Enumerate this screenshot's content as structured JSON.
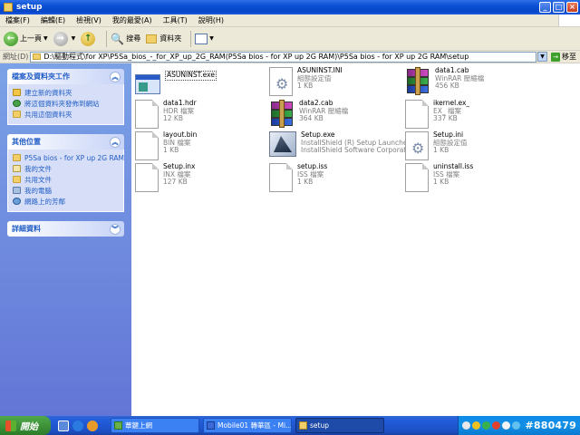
{
  "window": {
    "title": "setup"
  },
  "menu": [
    "檔案(F)",
    "編輯(E)",
    "檢視(V)",
    "我的最愛(A)",
    "工具(T)",
    "說明(H)"
  ],
  "toolbar": {
    "back": "上一頁",
    "search": "搜尋",
    "folders": "資料夾"
  },
  "address": {
    "label": "網址(D)",
    "value": "D:\\驅動程式\\for XP\\P5Sa_bios_-_for_XP_up_2G_RAM(P5Sa bios - for XP up 2G RAM)\\P5Sa bios - for XP up 2G RAM\\setup",
    "go": "移至"
  },
  "side": {
    "tasks": {
      "title": "檔案及資料夾工作",
      "items": [
        "建立新的資料夾",
        "將這個資料夾發佈到網站",
        "共用這個資料夾"
      ]
    },
    "places": {
      "title": "其他位置",
      "items": [
        "P5Sa bios - for XP up 2G RAM",
        "我的文件",
        "共用文件",
        "我的電腦",
        "網路上的芳鄰"
      ]
    },
    "details": {
      "title": "詳細資料"
    }
  },
  "files": [
    {
      "name": "ASUNINST.exe",
      "type": "",
      "size": "",
      "icon": "window-icon"
    },
    {
      "name": "ASUNINST.INI",
      "type": "組態設定值",
      "size": "1 KB",
      "icon": "gear-icon"
    },
    {
      "name": "data1.cab",
      "type": "WinRAR 壓縮檔",
      "size": "456 KB",
      "icon": "rar-icon"
    },
    {
      "name": "data1.hdr",
      "type": "HDR 檔案",
      "size": "12 KB",
      "icon": "file-icon"
    },
    {
      "name": "data2.cab",
      "type": "WinRAR 壓縮檔",
      "size": "364 KB",
      "icon": "rar-icon"
    },
    {
      "name": "ikernel.ex_",
      "type": "EX_ 檔案",
      "size": "337 KB",
      "icon": "file-icon"
    },
    {
      "name": "layout.bin",
      "type": "BIN 檔案",
      "size": "1 KB",
      "icon": "file-icon"
    },
    {
      "name": "Setup.exe",
      "type": "InstallShield (R) Setup Launcher",
      "size": "InstallShield Software Corporation",
      "icon": "installer-icon"
    },
    {
      "name": "Setup.ini",
      "type": "組態設定值",
      "size": "1 KB",
      "icon": "gear-icon"
    },
    {
      "name": "Setup.inx",
      "type": "INX 檔案",
      "size": "127 KB",
      "icon": "file-icon"
    },
    {
      "name": "setup.iss",
      "type": "ISS 檔案",
      "size": "1 KB",
      "icon": "file-icon"
    },
    {
      "name": "uninstall.iss",
      "type": "ISS 檔案",
      "size": "1 KB",
      "icon": "file-icon"
    }
  ],
  "taskbar": {
    "start": "開始",
    "tasks": [
      "蕈鍵上網",
      "Mobile01 轉華區 - Mi...",
      "setup"
    ],
    "watermark": "#880479"
  },
  "colors": {
    "titlebar": "#0a4fd4",
    "sidepanel": "#7ba2e7",
    "taskbar": "#245edb",
    "start": "#3c8f37"
  }
}
